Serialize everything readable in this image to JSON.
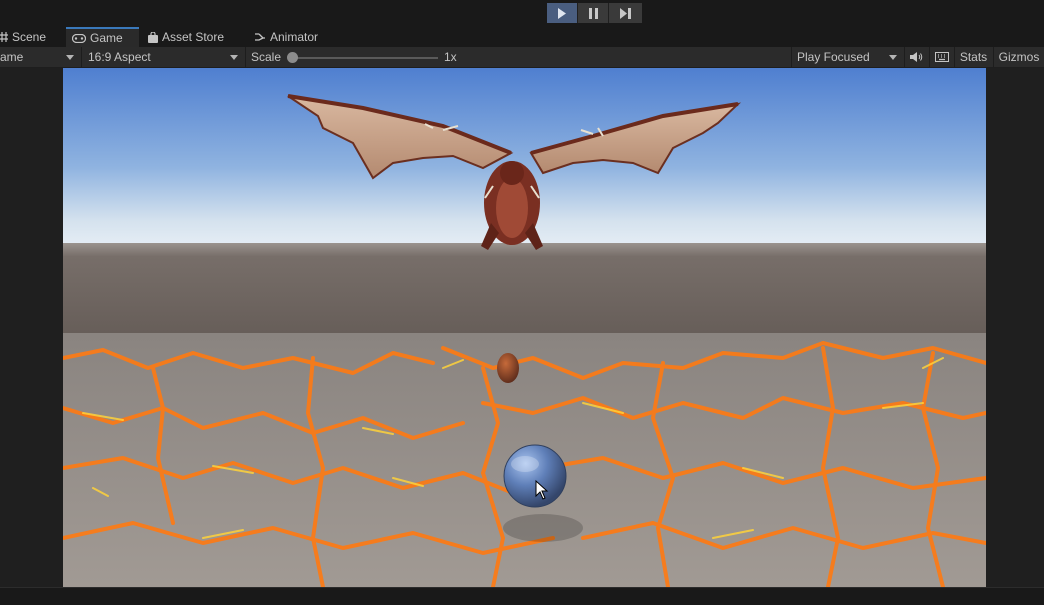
{
  "playbar": {
    "play_icon": "play-icon",
    "pause_icon": "pause-icon",
    "step_icon": "step-icon"
  },
  "tabs": [
    {
      "label": "Scene",
      "icon": "grid-icon"
    },
    {
      "label": "Game",
      "icon": "gamepad-icon",
      "active": true
    },
    {
      "label": "Asset Store",
      "icon": "shopping-bag-icon"
    },
    {
      "label": "Animator",
      "icon": "animator-icon"
    }
  ],
  "toolbar": {
    "display_label": "ame",
    "aspect_label": "16:9 Aspect",
    "scale_label": "Scale",
    "scale_value": "1x",
    "scale_fraction": 0,
    "play_mode_label": "Play Focused",
    "stats_label": "Stats",
    "gizmos_label": "Gizmos"
  },
  "colors": {
    "accent": "#3a79bb",
    "play_active": "#4a5e80",
    "sky_top": "#4f7fd0",
    "sky_horizon": "#e6eef5",
    "ground": "#6f6661",
    "lava": "#ff7a12"
  },
  "scene": {
    "objects": [
      "dragon",
      "dragon-egg",
      "glass-sphere"
    ]
  }
}
